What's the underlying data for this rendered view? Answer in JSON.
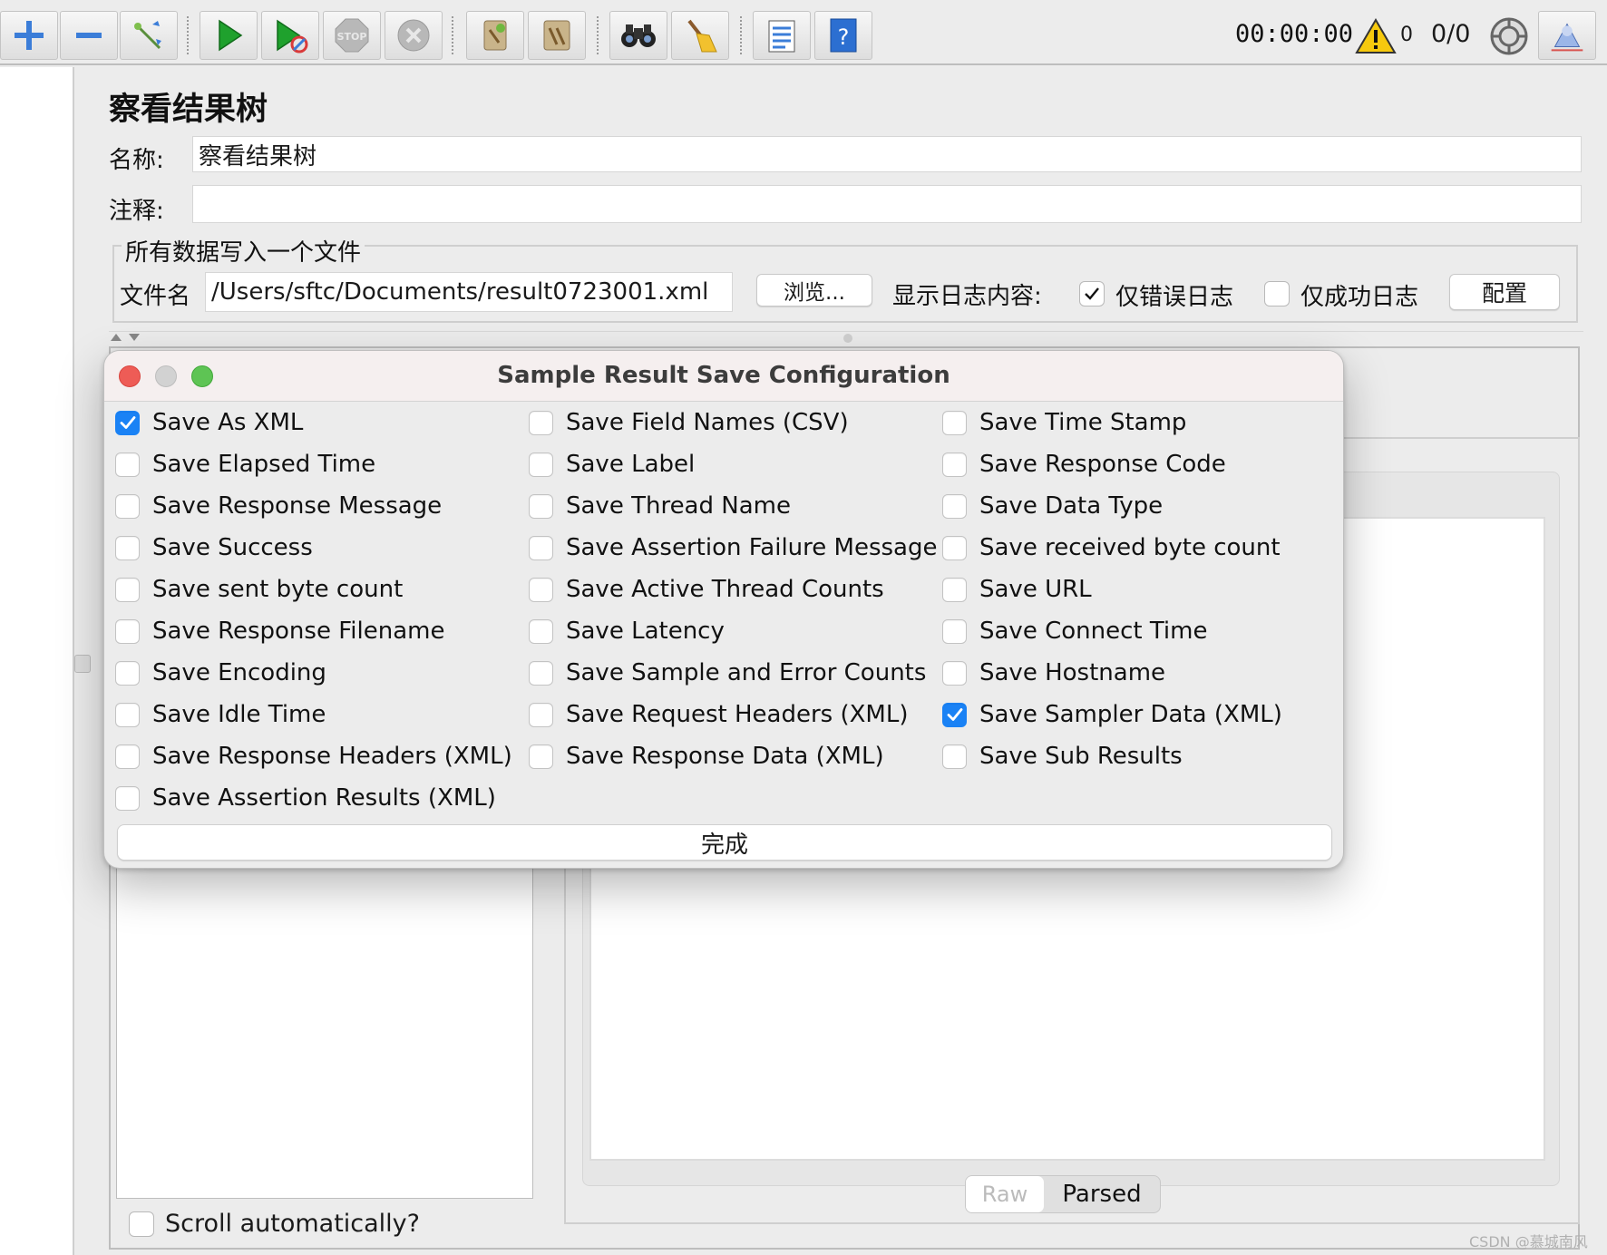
{
  "toolbar": {
    "timer": "00:00:00",
    "warning_count": "0",
    "threads": "0/0"
  },
  "panel": {
    "title": "察看结果树",
    "name_label": "名称:",
    "name_value": "察看结果树",
    "comment_label": "注释:",
    "comment_value": "",
    "group_title": "所有数据写入一个文件",
    "filename_label": "文件名",
    "filename_value": "/Users/sftc/Documents/result0723001.xml",
    "browse_label": "浏览...",
    "log_label": "显示日志内容:",
    "errors_only_label": "仅错误日志",
    "errors_only_checked": true,
    "success_only_label": "仅成功日志",
    "success_only_checked": false,
    "configure_label": "配置"
  },
  "results": {
    "scroll_label": "Scroll automatically?",
    "scroll_checked": false,
    "view_tabs": [
      "Raw",
      "Parsed"
    ]
  },
  "dialog": {
    "title": "Sample Result Save Configuration",
    "done_label": "完成",
    "columns": [
      [
        {
          "label": "Save As XML",
          "checked": true
        },
        {
          "label": "Save Elapsed Time",
          "checked": false
        },
        {
          "label": "Save Response Message",
          "checked": false
        },
        {
          "label": "Save Success",
          "checked": false
        },
        {
          "label": "Save sent byte count",
          "checked": false
        },
        {
          "label": "Save Response Filename",
          "checked": false
        },
        {
          "label": "Save Encoding",
          "checked": false
        },
        {
          "label": "Save Idle Time",
          "checked": false
        },
        {
          "label": "Save Response Headers (XML)",
          "checked": false
        },
        {
          "label": "Save Assertion Results (XML)",
          "checked": false
        }
      ],
      [
        {
          "label": "Save Field Names (CSV)",
          "checked": false
        },
        {
          "label": "Save Label",
          "checked": false
        },
        {
          "label": "Save Thread Name",
          "checked": false
        },
        {
          "label": "Save Assertion Failure Message",
          "checked": false
        },
        {
          "label": "Save Active Thread Counts",
          "checked": false
        },
        {
          "label": "Save Latency",
          "checked": false
        },
        {
          "label": "Save Sample and Error Counts",
          "checked": false
        },
        {
          "label": "Save Request Headers (XML)",
          "checked": false
        },
        {
          "label": "Save Response Data (XML)",
          "checked": false
        }
      ],
      [
        {
          "label": "Save Time Stamp",
          "checked": false
        },
        {
          "label": "Save Response Code",
          "checked": false
        },
        {
          "label": "Save Data Type",
          "checked": false
        },
        {
          "label": "Save received byte count",
          "checked": false
        },
        {
          "label": "Save URL",
          "checked": false
        },
        {
          "label": "Save Connect Time",
          "checked": false
        },
        {
          "label": "Save Hostname",
          "checked": false
        },
        {
          "label": "Save Sampler Data (XML)",
          "checked": true
        },
        {
          "label": "Save Sub Results",
          "checked": false
        }
      ]
    ]
  },
  "watermark": "CSDN @慕城南风",
  "colors": {
    "accent": "#1a82f5",
    "close": "#ee5c56",
    "minimize_disabled": "#d2d2d2",
    "zoom": "#5ec454"
  }
}
